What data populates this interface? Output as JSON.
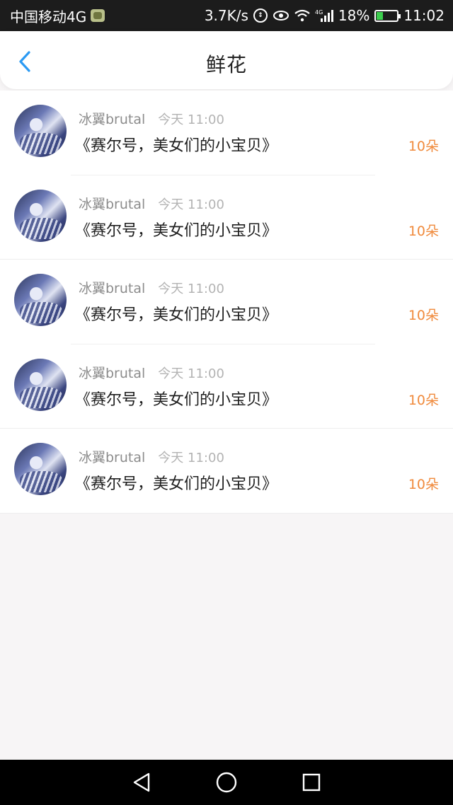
{
  "status_bar": {
    "carrier": "中国移动4G",
    "speed": "3.7K/s",
    "network": "4G",
    "battery": "18%",
    "time": "11:02"
  },
  "header": {
    "title": "鲜花"
  },
  "list": {
    "items": [
      {
        "user": "冰翼brutal",
        "time": "今天 11:00",
        "book": "《赛尔号，美女们的小宝贝》",
        "amount": "10朵"
      },
      {
        "user": "冰翼brutal",
        "time": "今天 11:00",
        "book": "《赛尔号，美女们的小宝贝》",
        "amount": "10朵"
      },
      {
        "user": "冰翼brutal",
        "time": "今天 11:00",
        "book": "《赛尔号，美女们的小宝贝》",
        "amount": "10朵"
      },
      {
        "user": "冰翼brutal",
        "time": "今天 11:00",
        "book": "《赛尔号，美女们的小宝贝》",
        "amount": "10朵"
      },
      {
        "user": "冰翼brutal",
        "time": "今天 11:00",
        "book": "《赛尔号，美女们的小宝贝》",
        "amount": "10朵"
      }
    ]
  },
  "colors": {
    "accent_blue": "#2b9af3",
    "amount_orange": "#f08a3c",
    "status_bar_bg": "#1c1c1c"
  },
  "icons": {
    "back": "chevron-left-icon",
    "nav_back": "triangle-back-icon",
    "nav_home": "circle-home-icon",
    "nav_recent": "square-recent-icon"
  }
}
